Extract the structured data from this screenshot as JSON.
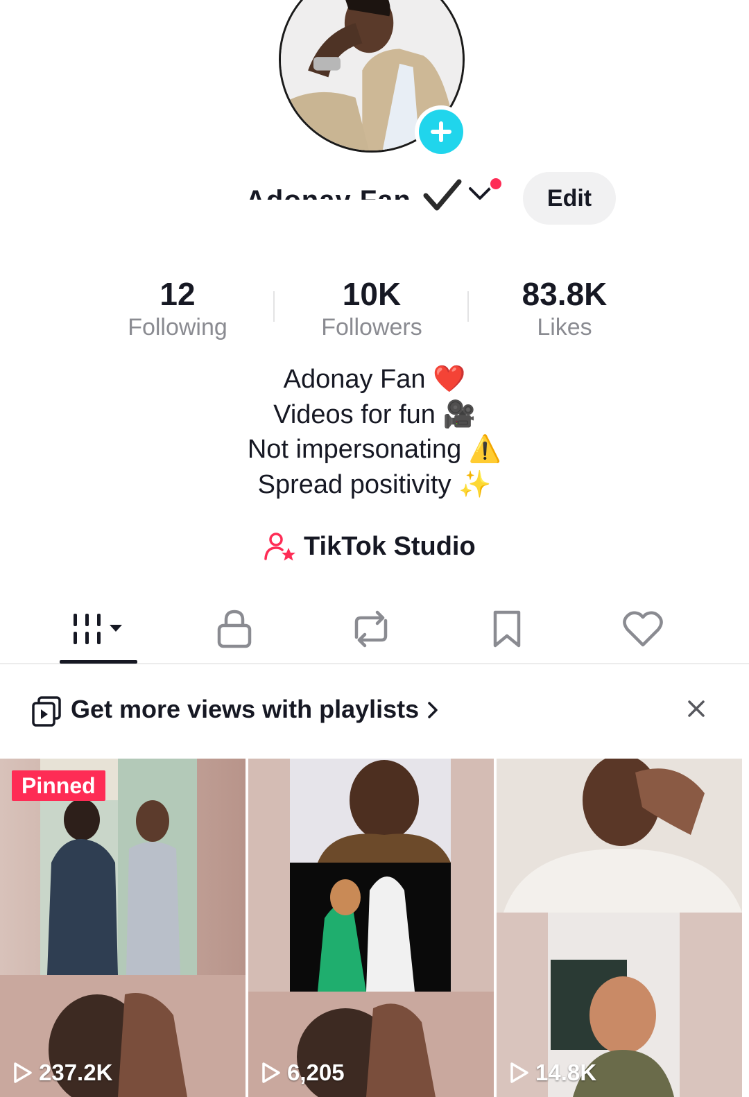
{
  "profile": {
    "username": "Adonay Fan",
    "edit_label": "Edit"
  },
  "stats": [
    {
      "value": "12",
      "label": "Following"
    },
    {
      "value": "10K",
      "label": "Followers"
    },
    {
      "value": "83.8K",
      "label": "Likes"
    }
  ],
  "bio": {
    "lines": [
      "Adonay Fan ❤️",
      "Videos for fun 🎥",
      "Not impersonating ⚠️",
      "Spread positivity ✨"
    ]
  },
  "studio": {
    "label": "TikTok Studio"
  },
  "tabs": [
    {
      "icon": "grid-videos-icon",
      "active": true
    },
    {
      "icon": "lock-icon",
      "active": false
    },
    {
      "icon": "repost-icon",
      "active": false
    },
    {
      "icon": "bookmark-icon",
      "active": false
    },
    {
      "icon": "heart-icon",
      "active": false
    }
  ],
  "banner": {
    "text": "Get more views with playlists"
  },
  "videos": [
    {
      "badge": "Pinned",
      "views": "237.2K"
    },
    {
      "badge": "",
      "views": "6,205"
    },
    {
      "badge": "",
      "views": "14.8K"
    }
  ],
  "colors": {
    "accent": "#fe2c55",
    "avatar_add": "#20d5ec",
    "muted_text": "#8a8b91"
  }
}
